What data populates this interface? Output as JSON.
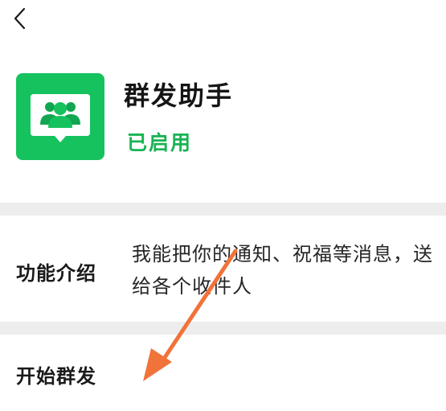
{
  "app": {
    "name": "群发助手",
    "status": "已启用",
    "icon": "group-people-chat-icon",
    "accent_color": "#15c25e",
    "status_color": "#17b352"
  },
  "navigation": {
    "back_icon": "chevron-left-icon"
  },
  "intro": {
    "label": "功能介绍",
    "description": "我能把你的通知、祝福等消息，送给各个收件人"
  },
  "actions": {
    "start_label": "开始群发"
  },
  "annotation": {
    "icon": "arrow-icon",
    "color": "#f0733a"
  }
}
